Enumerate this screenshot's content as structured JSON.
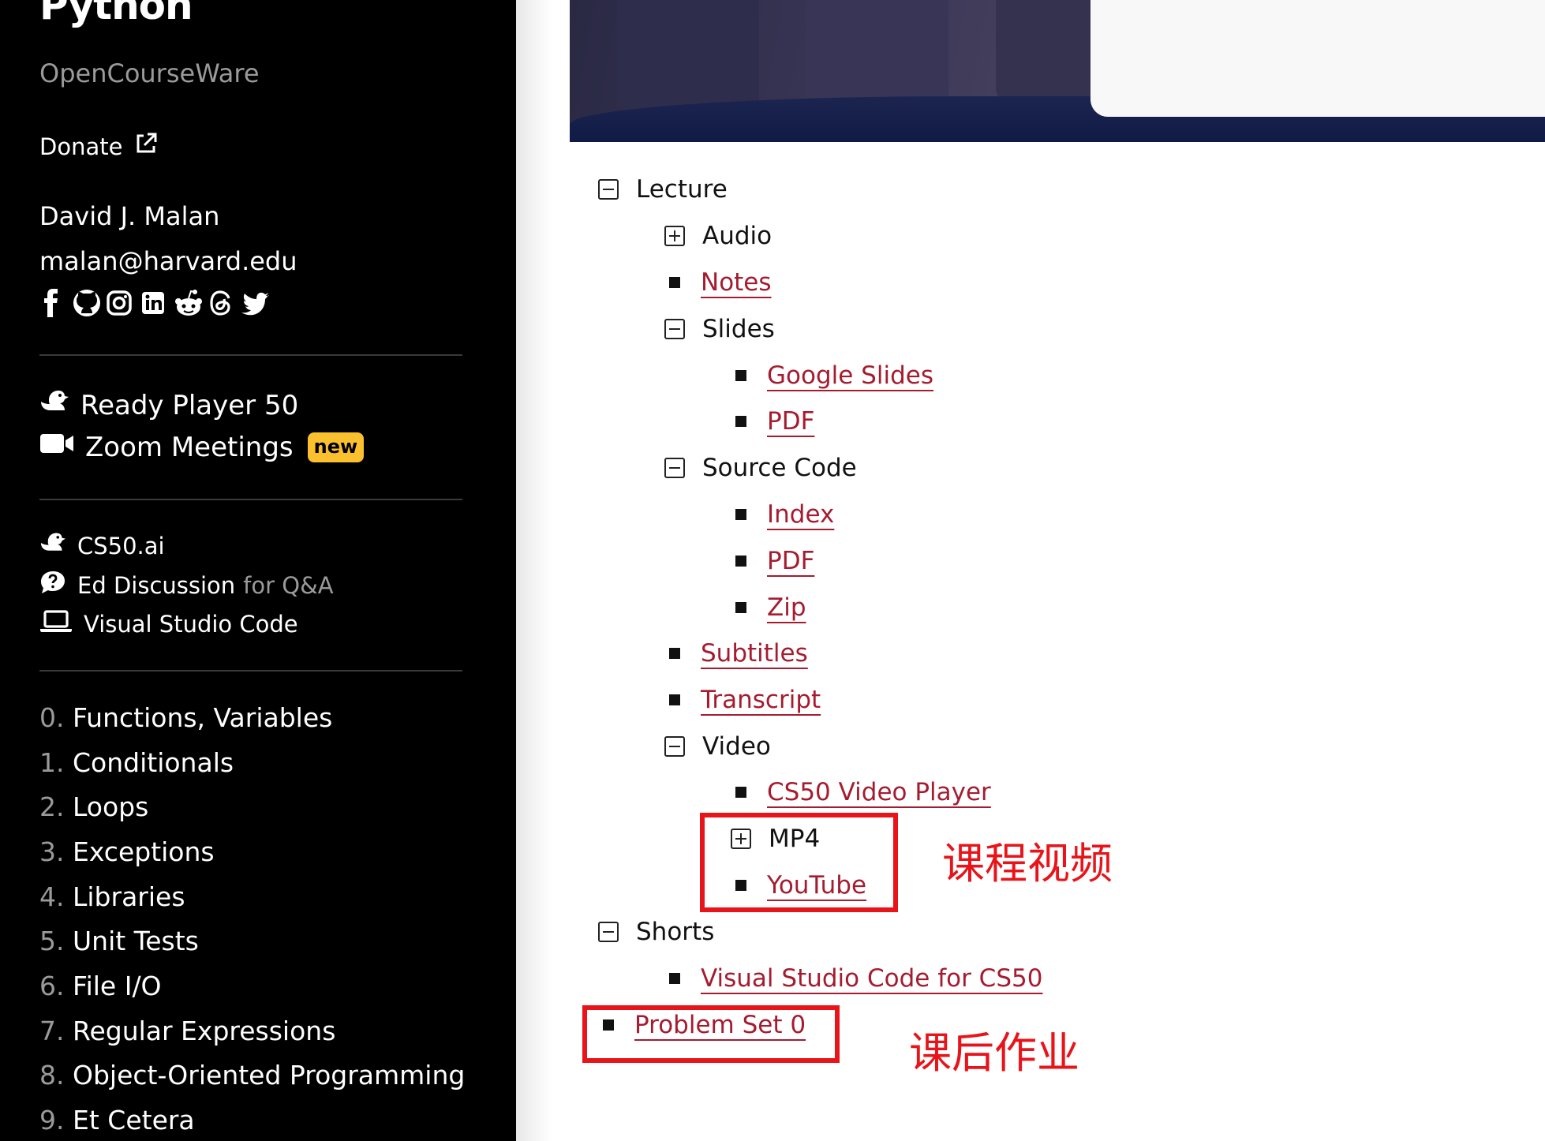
{
  "sidebar": {
    "title": "Python",
    "subtitle": "OpenCourseWare",
    "donate_label": "Donate",
    "author": {
      "name": "David J. Malan",
      "email": "malan@harvard.edu"
    },
    "social_icons": [
      "facebook-icon",
      "github-icon",
      "instagram-icon",
      "linkedin-icon",
      "reddit-icon",
      "threads-icon",
      "twitter-icon"
    ],
    "featured": [
      {
        "icon": "duck-icon",
        "label": "Ready Player 50"
      },
      {
        "icon": "video-camera-icon",
        "label": "Zoom Meetings",
        "badge": "new"
      }
    ],
    "tools": [
      {
        "icon": "duck-icon",
        "label": "CS50.ai"
      },
      {
        "icon": "chat-question-icon",
        "label": "Ed Discussion",
        "suffix": "for Q&A"
      },
      {
        "icon": "laptop-icon",
        "label": "Visual Studio Code"
      }
    ],
    "lectures": [
      {
        "num": "0.",
        "title": "Functions, Variables"
      },
      {
        "num": "1.",
        "title": "Conditionals"
      },
      {
        "num": "2.",
        "title": "Loops"
      },
      {
        "num": "3.",
        "title": "Exceptions"
      },
      {
        "num": "4.",
        "title": "Libraries"
      },
      {
        "num": "5.",
        "title": "Unit Tests"
      },
      {
        "num": "6.",
        "title": "File I/O"
      },
      {
        "num": "7.",
        "title": "Regular Expressions"
      },
      {
        "num": "8.",
        "title": "Object-Oriented Programming"
      },
      {
        "num": "9.",
        "title": "Et Cetera"
      }
    ]
  },
  "main": {
    "tree": {
      "lecture": "Lecture",
      "audio": "Audio",
      "notes": "Notes",
      "slides": "Slides",
      "google_slides": "Google Slides",
      "slides_pdf": "PDF",
      "source_code": "Source Code",
      "index": "Index",
      "code_pdf": "PDF",
      "zip": "Zip",
      "subtitles": "Subtitles",
      "transcript": "Transcript",
      "video": "Video",
      "cs50_video_player": "CS50 Video Player",
      "mp4": "MP4",
      "youtube": "YouTube",
      "shorts": "Shorts",
      "vscode_for_cs50": "Visual Studio Code for CS50",
      "problem_set": "Problem Set 0"
    },
    "annotations": {
      "video_note": "课程视频",
      "homework_note": "课后作业",
      "color": "#e8141a"
    },
    "link_color": "#a51c30",
    "badge_color": "#fbc02d"
  }
}
